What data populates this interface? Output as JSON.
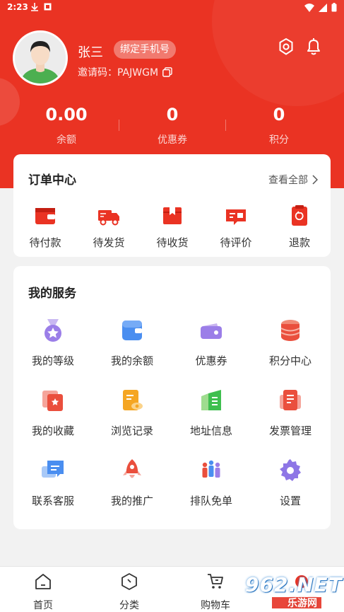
{
  "status_bar": {
    "time": "2:23",
    "icons_left": [
      "download-icon",
      "notification-icon"
    ],
    "icons_right": [
      "wifi-icon",
      "signal-icon",
      "battery-icon"
    ]
  },
  "profile": {
    "name": "张三",
    "bind_phone_label": "绑定手机号",
    "invite_code": "邀请码：PAJWGM",
    "icons": [
      "settings-icon",
      "bell-icon",
      "copy-icon"
    ]
  },
  "stats": [
    {
      "value": "0.00",
      "label": "余额"
    },
    {
      "value": "0",
      "label": "优惠券"
    },
    {
      "value": "0",
      "label": "积分"
    }
  ],
  "orders": {
    "title": "订单中心",
    "view_all": "查看全部",
    "items": [
      {
        "label": "待付款",
        "icon": "wallet-icon"
      },
      {
        "label": "待发货",
        "icon": "truck-icon"
      },
      {
        "label": "待收货",
        "icon": "package-icon"
      },
      {
        "label": "待评价",
        "icon": "review-icon"
      },
      {
        "label": "退款",
        "icon": "refund-icon"
      }
    ]
  },
  "services": {
    "title": "我的服务",
    "items": [
      {
        "label": "我的等级",
        "icon": "medal-icon"
      },
      {
        "label": "我的余额",
        "icon": "wallet-blue-icon"
      },
      {
        "label": "优惠券",
        "icon": "coupon-icon"
      },
      {
        "label": "积分中心",
        "icon": "coins-icon"
      },
      {
        "label": "我的收藏",
        "icon": "favorites-icon"
      },
      {
        "label": "浏览记录",
        "icon": "history-icon"
      },
      {
        "label": "地址信息",
        "icon": "address-icon"
      },
      {
        "label": "发票管理",
        "icon": "invoice-icon"
      },
      {
        "label": "联系客服",
        "icon": "chat-icon"
      },
      {
        "label": "我的推广",
        "icon": "rocket-icon"
      },
      {
        "label": "排队免单",
        "icon": "queue-icon"
      },
      {
        "label": "设置",
        "icon": "gear-icon"
      }
    ]
  },
  "tabbar": {
    "items": [
      {
        "label": "首页",
        "icon": "home-icon"
      },
      {
        "label": "分类",
        "icon": "category-icon"
      },
      {
        "label": "购物车",
        "icon": "cart-icon"
      }
    ]
  },
  "watermark": {
    "main": "962.NET",
    "sub": "乐游网"
  },
  "colors": {
    "brand": "#ea3323",
    "background": "#f2f2f2"
  }
}
